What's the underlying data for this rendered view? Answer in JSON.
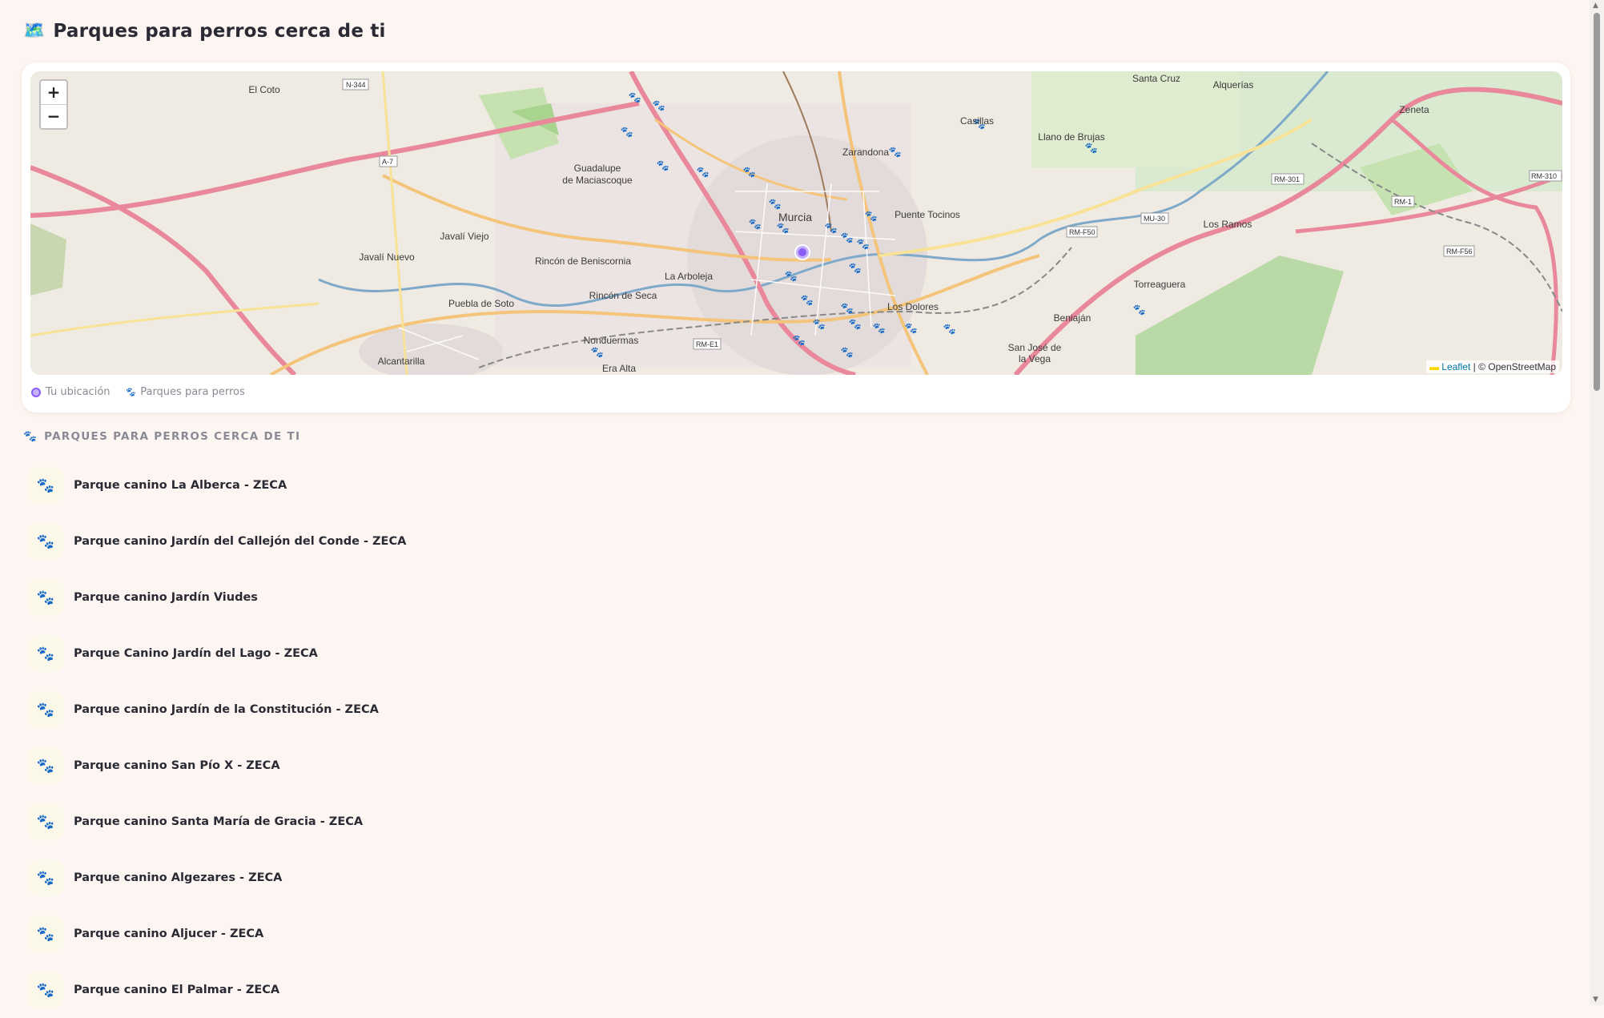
{
  "header": {
    "icon": "map-icon",
    "title": "Parques para perros cerca de ti"
  },
  "map": {
    "zoom_in_label": "+",
    "zoom_out_label": "−",
    "attribution_leaflet": "Leaflet",
    "attribution_rest": "| © OpenStreetMap",
    "place_labels": [
      "El Coto",
      "Santa Cruz",
      "Alquerías",
      "Zeneta",
      "Casillas",
      "Llano de Brujas",
      "Zarandona",
      "Guadalupe de Maciascoque",
      "Murcia",
      "Puente Tocinos",
      "Javalí Viejo",
      "Javalí Nuevo",
      "Rincón de Beniscornia",
      "La Arboleja",
      "Rincón de Seca",
      "Puebla de Soto",
      "Nonduermas",
      "Alcantarilla",
      "Era Alta",
      "Los Dolores",
      "Beniaján",
      "San José de la Vega",
      "Torreaguera",
      "Los Ramos"
    ],
    "road_labels": [
      "N-344",
      "A-7",
      "RM-301",
      "RM-1",
      "RM-310",
      "RM-F50",
      "MU-30",
      "RM-F56",
      "RM-E1"
    ]
  },
  "legend": {
    "you_label": "Tu ubicación",
    "parks_label": "Parques para perros"
  },
  "section": {
    "icon": "paw-icon",
    "title": "PARQUES PARA PERROS CERCA DE TI"
  },
  "parks": [
    {
      "name": "Parque canino La Alberca - ZECA"
    },
    {
      "name": "Parque canino Jardín del Callejón del Conde - ZECA"
    },
    {
      "name": "Parque canino Jardín Viudes"
    },
    {
      "name": "Parque Canino Jardín del Lago - ZECA"
    },
    {
      "name": "Parque canino Jardín de la Constitución - ZECA"
    },
    {
      "name": "Parque canino San Pío X - ZECA"
    },
    {
      "name": "Parque canino Santa María de Gracia - ZECA"
    },
    {
      "name": "Parque canino Algezares - ZECA"
    },
    {
      "name": "Parque canino Aljucer - ZECA"
    },
    {
      "name": "Parque canino El Palmar - ZECA"
    }
  ],
  "colors": {
    "accent": "#8b5cf6",
    "background": "#fdf5f1",
    "motorway": "#e8889a",
    "river": "#7fa9c9"
  }
}
